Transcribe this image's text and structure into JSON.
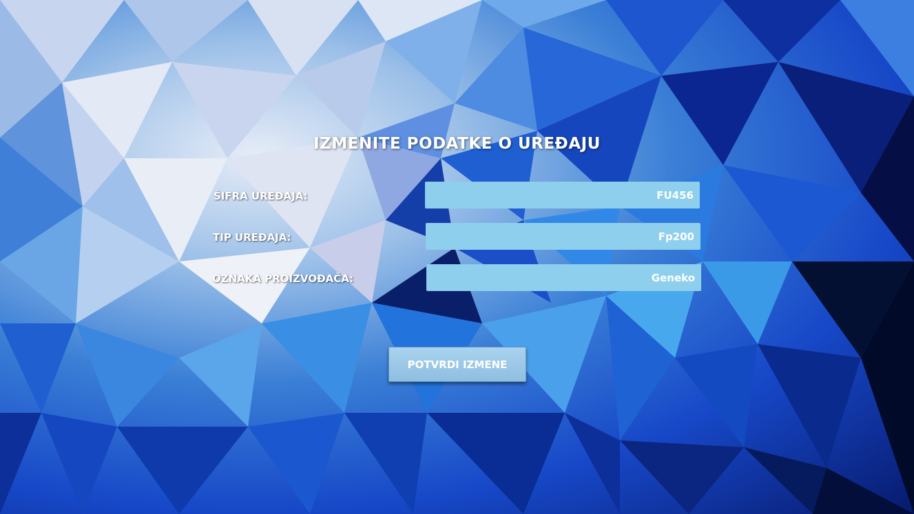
{
  "form": {
    "title": "IZMENITE PODATKE O UREĐAJU",
    "fields": [
      {
        "label": "ŠIFRA UREĐAJA:",
        "value": "FU456"
      },
      {
        "label": "TIP UREĐAJA:",
        "value": "Fp200"
      },
      {
        "label": "OZNAKA PROIZVOĐAČA:",
        "value": "Geneko"
      }
    ],
    "submit_label": "POTVRDI IZMENE"
  },
  "colors": {
    "field_background": "#8ecfee",
    "button_background": "#9ccbe9",
    "text": "#ffffff"
  }
}
